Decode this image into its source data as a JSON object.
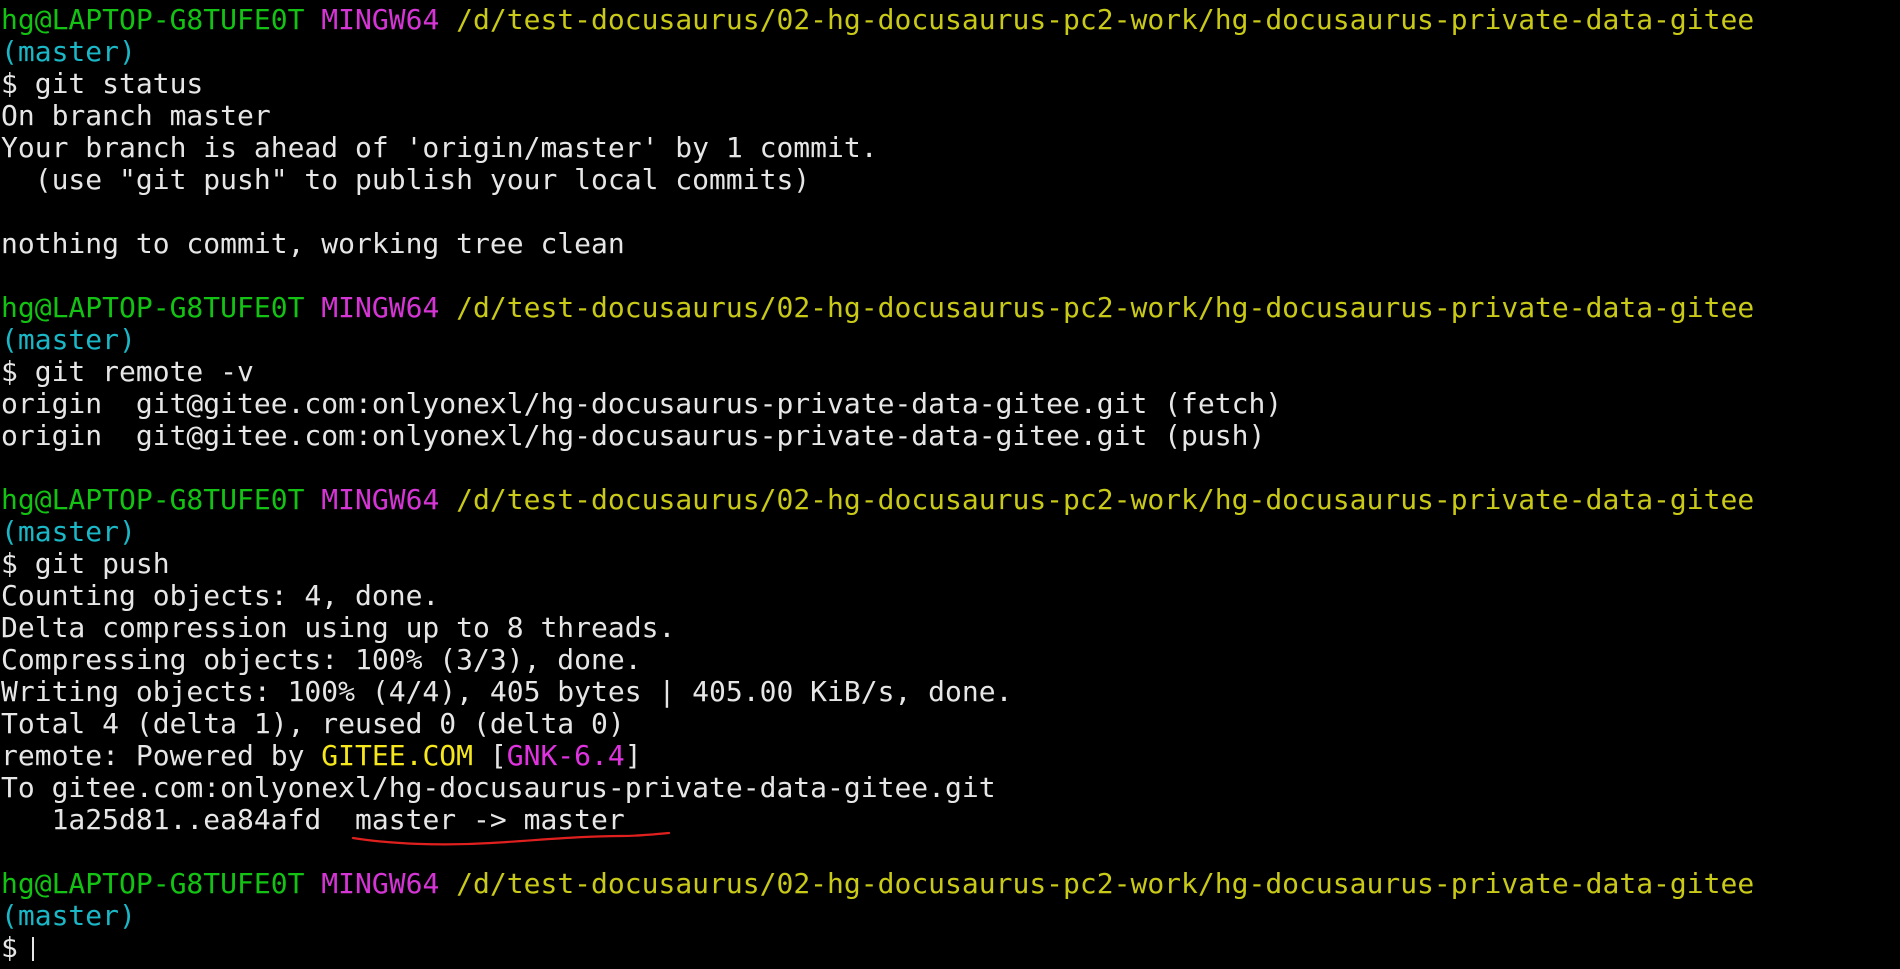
{
  "prompt": {
    "user_host": "hg@LAPTOP-G8TUFE0T",
    "system": "MINGW64",
    "path": "/d/test-docusaurus/02-hg-docusaurus-pc2-work/hg-docusaurus-private-data-gitee",
    "branch": "(master)",
    "symbol": "$"
  },
  "blocks": [
    {
      "command": "git status",
      "output": [
        "On branch master",
        "Your branch is ahead of 'origin/master' by 1 commit.",
        "  (use \"git push\" to publish your local commits)",
        "",
        "nothing to commit, working tree clean",
        ""
      ]
    },
    {
      "command": "git remote -v",
      "output": [
        "origin  git@gitee.com:onlyonexl/hg-docusaurus-private-data-gitee.git (fetch)",
        "origin  git@gitee.com:onlyonexl/hg-docusaurus-private-data-gitee.git (push)",
        ""
      ]
    },
    {
      "command": "git push",
      "output": [
        "Counting objects: 4, done.",
        "Delta compression using up to 8 threads.",
        "Compressing objects: 100% (3/3), done.",
        "Writing objects: 100% (4/4), 405 bytes | 405.00 KiB/s, done.",
        "Total 4 (delta 1), reused 0 (delta 0)"
      ],
      "remote_line": {
        "prefix": "remote: Powered by ",
        "gitee": "GITEE.COM",
        "bracket_open": " [",
        "gnk": "GNK-6.4",
        "bracket_close": "]"
      },
      "to_line": "To gitee.com:onlyonexl/hg-docusaurus-private-data-gitee.git",
      "ref_line": {
        "hashes": "   1a25d81..ea84afd  ",
        "refs": "master -> master"
      }
    }
  ],
  "annotation": {
    "underline_color": "#e0201e"
  }
}
